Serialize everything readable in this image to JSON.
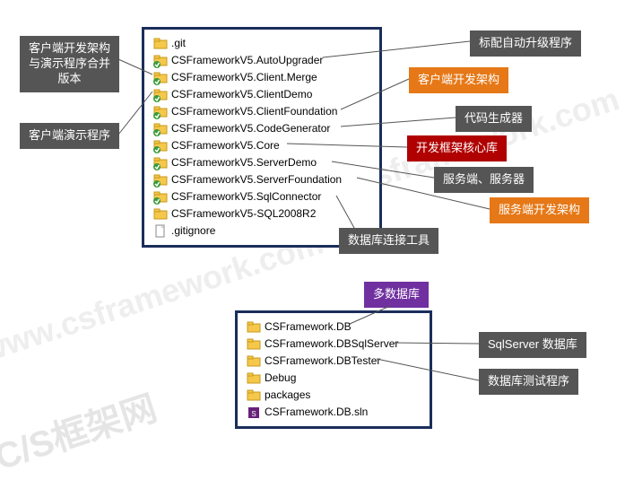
{
  "watermarks": {
    "w1": "www.csframework.com",
    "w2": "www.csframework.com",
    "w3": "C/S框架网"
  },
  "panel1": {
    "items": [
      ".git",
      "CSFrameworkV5.AutoUpgrader",
      "CSFrameworkV5.Client.Merge",
      "CSFrameworkV5.ClientDemo",
      "CSFrameworkV5.ClientFoundation",
      "CSFrameworkV5.CodeGenerator",
      "CSFrameworkV5.Core",
      "CSFrameworkV5.ServerDemo",
      "CSFrameworkV5.ServerFoundation",
      "CSFrameworkV5.SqlConnector",
      "CSFrameworkV5-SQL2008R2",
      ".gitignore"
    ]
  },
  "panel2": {
    "items": [
      "CSFramework.DB",
      "CSFramework.DBSqlServer",
      "CSFramework.DBTester",
      "Debug",
      "packages",
      "CSFramework.DB.sln"
    ]
  },
  "callouts": {
    "c_merge": "客户端开发架构\n与演示程序合并\n版本",
    "c_demo": "客户端演示程序",
    "c_auto": "标配自动升级程序",
    "c_clientfx": "客户端开发架构",
    "c_codegen": "代码生成器",
    "c_core": "开发框架核心库",
    "c_server": "服务端、服务器",
    "c_serverfx": "服务端开发架构",
    "c_sqlconn": "数据库连接工具",
    "c_multidb": "多数据库",
    "c_sqlserver": "SqlServer 数据库",
    "c_dbtester": "数据库测试程序"
  }
}
